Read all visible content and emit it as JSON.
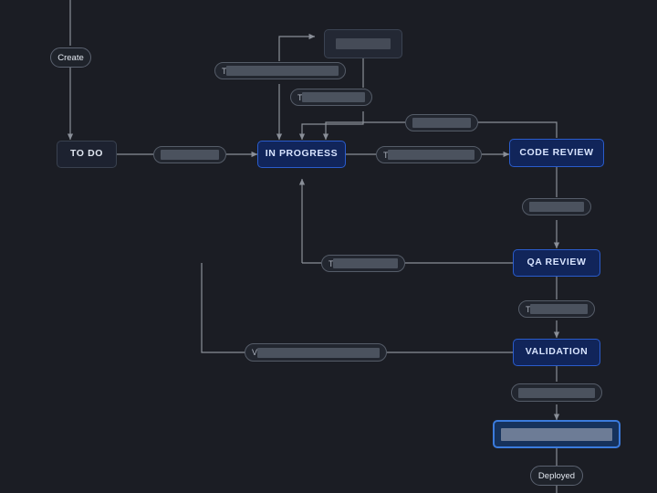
{
  "canvas": {
    "background": "#1b1d24",
    "edge_color": "#8a8f98",
    "accent_blue": "#2a5ccc",
    "selected_blue": "#3b7bdd"
  },
  "events": [
    {
      "id": "create",
      "label": "Create"
    },
    {
      "id": "deployed",
      "label": "Deployed"
    }
  ],
  "statuses": [
    {
      "id": "todo",
      "label": "TO DO",
      "style": "default"
    },
    {
      "id": "in-progress",
      "label": "IN PROGRESS",
      "style": "active"
    },
    {
      "id": "code-review",
      "label": "CODE REVIEW",
      "style": "active"
    },
    {
      "id": "qa-review",
      "label": "QA REVIEW",
      "style": "active"
    },
    {
      "id": "validation",
      "label": "VALIDATION",
      "style": "active"
    },
    {
      "id": "status-top",
      "label": "",
      "style": "plain",
      "redacted": true
    },
    {
      "id": "status-selected",
      "label": "",
      "style": "selected",
      "redacted": true
    }
  ],
  "transitions": [
    {
      "id": "t-todo-inprogress",
      "label": "",
      "redacted": true,
      "prefix": ""
    },
    {
      "id": "t-top-long",
      "label": "",
      "redacted": true,
      "prefix": "T"
    },
    {
      "id": "t-top-short",
      "label": "",
      "redacted": true,
      "prefix": "T"
    },
    {
      "id": "t-codereview-in",
      "label": "",
      "redacted": true,
      "prefix": ""
    },
    {
      "id": "t-inprogress-codereview",
      "label": "",
      "redacted": true,
      "prefix": "T"
    },
    {
      "id": "t-codereview-qareview",
      "label": "",
      "redacted": true,
      "prefix": ""
    },
    {
      "id": "t-qareview-validation",
      "label": "",
      "redacted": true,
      "prefix": "T"
    },
    {
      "id": "t-back-to-inprogress",
      "label": "",
      "redacted": true,
      "prefix": "T"
    },
    {
      "id": "t-validation-back",
      "label": "",
      "redacted": true,
      "prefix": "V"
    },
    {
      "id": "t-validation-deploy",
      "label": "",
      "redacted": true,
      "prefix": ""
    }
  ]
}
